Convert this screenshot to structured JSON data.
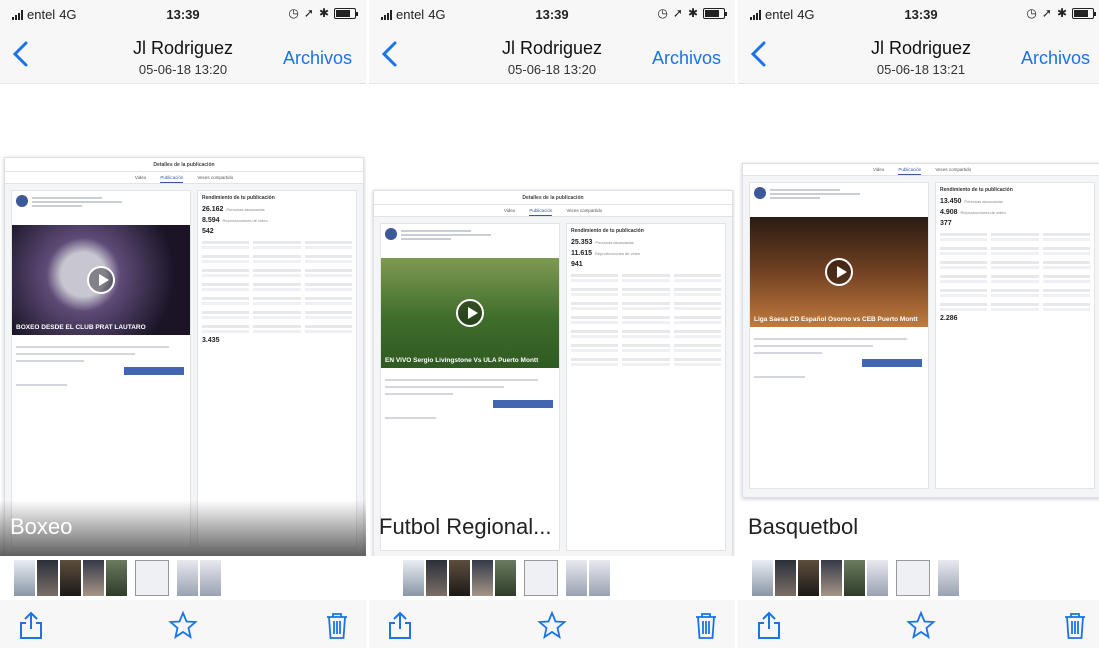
{
  "screens": [
    {
      "status": {
        "carrier": "entel",
        "network": "4G",
        "time": "13:39"
      },
      "nav": {
        "title": "Jl Rodriguez",
        "subtitle": "05-06-18 13:20",
        "right_label": "Archivos"
      },
      "post": {
        "dialog_title": "Detalles de la publicación",
        "tabs": [
          "Video",
          "Publicación",
          "Veces compartido"
        ],
        "stats_title": "Rendimiento de tu publicación",
        "stat1": "26.162",
        "stat1_label": "Personas alcanzadas",
        "stat2": "8.594",
        "stat2_label": "Reproducciones de video",
        "stat3": "542",
        "clicks": "3.435",
        "video_caption": "BOXEO DESDE EL CLUB PRAT LAUTARO"
      },
      "caption": "Boxeo"
    },
    {
      "status": {
        "carrier": "entel",
        "network": "4G",
        "time": "13:39"
      },
      "nav": {
        "title": "Jl Rodriguez",
        "subtitle": "05-06-18 13:20",
        "right_label": "Archivos"
      },
      "post": {
        "dialog_title": "Detalles de la publicación",
        "tabs": [
          "Video",
          "Publicación",
          "Veces compartido"
        ],
        "stats_title": "Rendimiento de tu publicación",
        "stat1": "25.353",
        "stat1_label": "Personas alcanzadas",
        "stat2": "11.615",
        "stat2_label": "Reproducciones de video",
        "stat3": "941",
        "clicks": "",
        "video_caption": "EN VIVO Sergio Livingstone Vs ULA Puerto Montt"
      },
      "caption": "Futbol Regional..."
    },
    {
      "status": {
        "carrier": "entel",
        "network": "4G",
        "time": "13:39"
      },
      "nav": {
        "title": "Jl Rodriguez",
        "subtitle": "05-06-18 13:21",
        "right_label": "Archivos"
      },
      "post": {
        "dialog_title": "",
        "tabs": [
          "Video",
          "Publicación",
          "Veces compartido"
        ],
        "stats_title": "Rendimiento de tu publicación",
        "stat1": "13.450",
        "stat1_label": "Personas alcanzadas",
        "stat2": "4.908",
        "stat2_label": "Reproducciones de video",
        "stat3": "377",
        "clicks": "2.286",
        "video_caption": "Liga Saesa CD Español Osorno vs CEB Puerto Montt"
      },
      "caption": "Basquetbol"
    }
  ],
  "icons": [
    "signal-bars-icon",
    "back-chevron-icon",
    "share-icon",
    "favorite-star-icon",
    "trash-icon",
    "battery-icon",
    "play-icon"
  ],
  "colors": {
    "ios_blue": "#1a73e8",
    "facebook_blue": "#3b5998",
    "bar_bg": "#f7f7f7"
  }
}
